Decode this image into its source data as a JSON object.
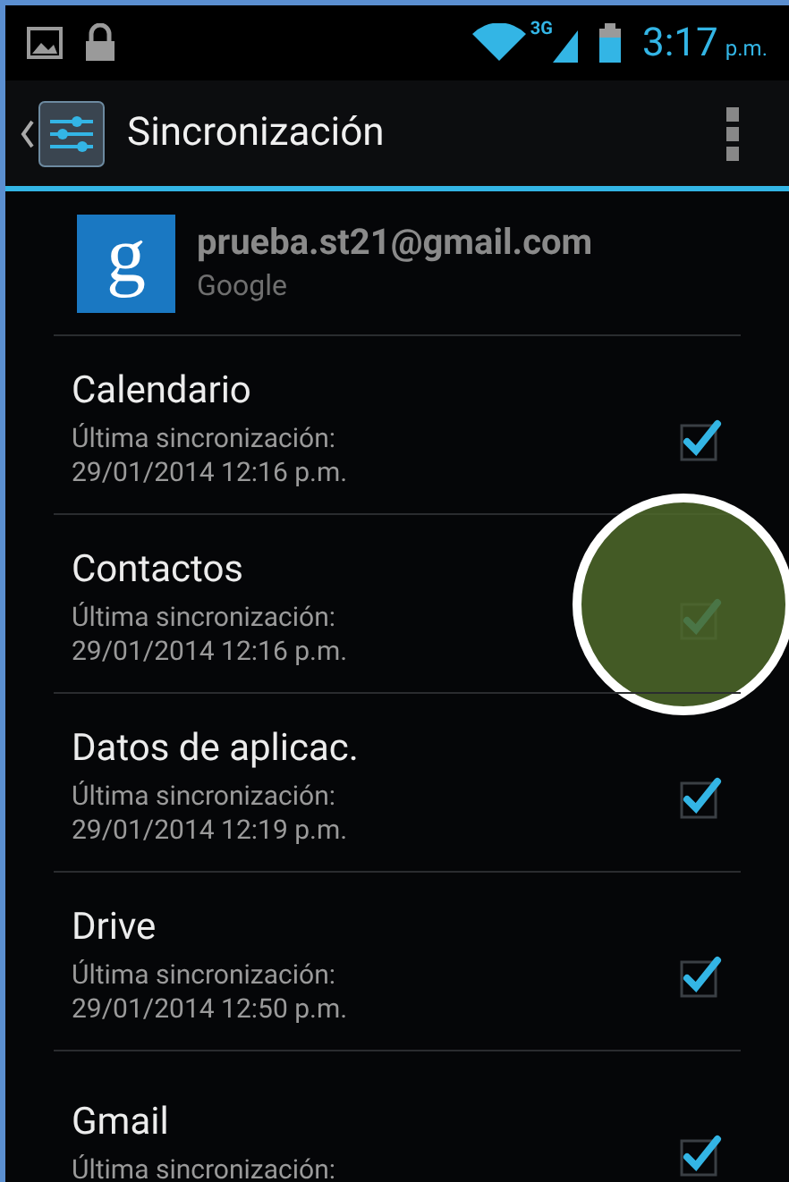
{
  "status_bar": {
    "time": "3:17",
    "ampm": "p.m.",
    "network": "3G"
  },
  "action_bar": {
    "title": "Sincronización"
  },
  "account": {
    "email": "prueba.st21@gmail.com",
    "type": "Google",
    "logo_letter": "g"
  },
  "items": [
    {
      "name": "Calendario",
      "label": "Última sincronización:",
      "date": "29/01/2014 12:16 p.m.",
      "checked": true,
      "highlighted": false
    },
    {
      "name": "Contactos",
      "label": "Última sincronización:",
      "date": "29/01/2014 12:16 p.m.",
      "checked": true,
      "highlighted": true
    },
    {
      "name": "Datos de aplicac.",
      "label": "Última sincronización:",
      "date": "29/01/2014 12:19 p.m.",
      "checked": true,
      "highlighted": false
    },
    {
      "name": "Drive",
      "label": "Última sincronización:",
      "date": "29/01/2014 12:50 p.m.",
      "checked": true,
      "highlighted": false
    },
    {
      "name": "Gmail",
      "label": "Última sincronización:",
      "checked": true,
      "highlighted": false
    }
  ]
}
